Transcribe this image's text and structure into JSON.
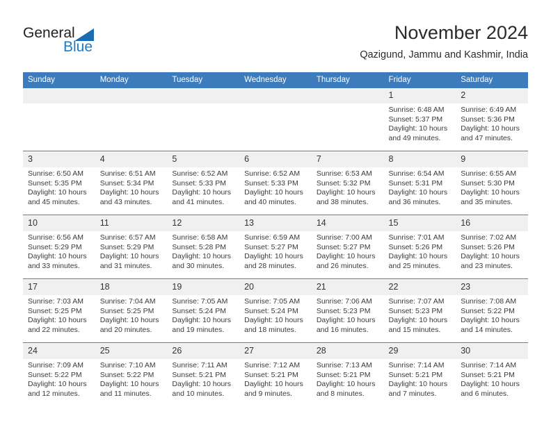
{
  "brand": {
    "name_part1": "General",
    "name_part2": "Blue",
    "triangle_icon": "blue-triangle-icon",
    "color_dark": "#231f20",
    "color_blue": "#1b7bc4"
  },
  "header": {
    "title": "November 2024",
    "subtitle": "Qazigund, Jammu and Kashmir, India"
  },
  "theme": {
    "header_blue": "#3c7cbd",
    "daynum_band": "#f0f0f0",
    "text": "#2b2b2b"
  },
  "calendar": {
    "weekday_headers": [
      "Sunday",
      "Monday",
      "Tuesday",
      "Wednesday",
      "Thursday",
      "Friday",
      "Saturday"
    ],
    "weeks": [
      [
        {
          "day": "",
          "lines": []
        },
        {
          "day": "",
          "lines": []
        },
        {
          "day": "",
          "lines": []
        },
        {
          "day": "",
          "lines": []
        },
        {
          "day": "",
          "lines": []
        },
        {
          "day": "1",
          "lines": [
            "Sunrise: 6:48 AM",
            "Sunset: 5:37 PM",
            "Daylight: 10 hours",
            "and 49 minutes."
          ]
        },
        {
          "day": "2",
          "lines": [
            "Sunrise: 6:49 AM",
            "Sunset: 5:36 PM",
            "Daylight: 10 hours",
            "and 47 minutes."
          ]
        }
      ],
      [
        {
          "day": "3",
          "lines": [
            "Sunrise: 6:50 AM",
            "Sunset: 5:35 PM",
            "Daylight: 10 hours",
            "and 45 minutes."
          ]
        },
        {
          "day": "4",
          "lines": [
            "Sunrise: 6:51 AM",
            "Sunset: 5:34 PM",
            "Daylight: 10 hours",
            "and 43 minutes."
          ]
        },
        {
          "day": "5",
          "lines": [
            "Sunrise: 6:52 AM",
            "Sunset: 5:33 PM",
            "Daylight: 10 hours",
            "and 41 minutes."
          ]
        },
        {
          "day": "6",
          "lines": [
            "Sunrise: 6:52 AM",
            "Sunset: 5:33 PM",
            "Daylight: 10 hours",
            "and 40 minutes."
          ]
        },
        {
          "day": "7",
          "lines": [
            "Sunrise: 6:53 AM",
            "Sunset: 5:32 PM",
            "Daylight: 10 hours",
            "and 38 minutes."
          ]
        },
        {
          "day": "8",
          "lines": [
            "Sunrise: 6:54 AM",
            "Sunset: 5:31 PM",
            "Daylight: 10 hours",
            "and 36 minutes."
          ]
        },
        {
          "day": "9",
          "lines": [
            "Sunrise: 6:55 AM",
            "Sunset: 5:30 PM",
            "Daylight: 10 hours",
            "and 35 minutes."
          ]
        }
      ],
      [
        {
          "day": "10",
          "lines": [
            "Sunrise: 6:56 AM",
            "Sunset: 5:29 PM",
            "Daylight: 10 hours",
            "and 33 minutes."
          ]
        },
        {
          "day": "11",
          "lines": [
            "Sunrise: 6:57 AM",
            "Sunset: 5:29 PM",
            "Daylight: 10 hours",
            "and 31 minutes."
          ]
        },
        {
          "day": "12",
          "lines": [
            "Sunrise: 6:58 AM",
            "Sunset: 5:28 PM",
            "Daylight: 10 hours",
            "and 30 minutes."
          ]
        },
        {
          "day": "13",
          "lines": [
            "Sunrise: 6:59 AM",
            "Sunset: 5:27 PM",
            "Daylight: 10 hours",
            "and 28 minutes."
          ]
        },
        {
          "day": "14",
          "lines": [
            "Sunrise: 7:00 AM",
            "Sunset: 5:27 PM",
            "Daylight: 10 hours",
            "and 26 minutes."
          ]
        },
        {
          "day": "15",
          "lines": [
            "Sunrise: 7:01 AM",
            "Sunset: 5:26 PM",
            "Daylight: 10 hours",
            "and 25 minutes."
          ]
        },
        {
          "day": "16",
          "lines": [
            "Sunrise: 7:02 AM",
            "Sunset: 5:26 PM",
            "Daylight: 10 hours",
            "and 23 minutes."
          ]
        }
      ],
      [
        {
          "day": "17",
          "lines": [
            "Sunrise: 7:03 AM",
            "Sunset: 5:25 PM",
            "Daylight: 10 hours",
            "and 22 minutes."
          ]
        },
        {
          "day": "18",
          "lines": [
            "Sunrise: 7:04 AM",
            "Sunset: 5:25 PM",
            "Daylight: 10 hours",
            "and 20 minutes."
          ]
        },
        {
          "day": "19",
          "lines": [
            "Sunrise: 7:05 AM",
            "Sunset: 5:24 PM",
            "Daylight: 10 hours",
            "and 19 minutes."
          ]
        },
        {
          "day": "20",
          "lines": [
            "Sunrise: 7:05 AM",
            "Sunset: 5:24 PM",
            "Daylight: 10 hours",
            "and 18 minutes."
          ]
        },
        {
          "day": "21",
          "lines": [
            "Sunrise: 7:06 AM",
            "Sunset: 5:23 PM",
            "Daylight: 10 hours",
            "and 16 minutes."
          ]
        },
        {
          "day": "22",
          "lines": [
            "Sunrise: 7:07 AM",
            "Sunset: 5:23 PM",
            "Daylight: 10 hours",
            "and 15 minutes."
          ]
        },
        {
          "day": "23",
          "lines": [
            "Sunrise: 7:08 AM",
            "Sunset: 5:22 PM",
            "Daylight: 10 hours",
            "and 14 minutes."
          ]
        }
      ],
      [
        {
          "day": "24",
          "lines": [
            "Sunrise: 7:09 AM",
            "Sunset: 5:22 PM",
            "Daylight: 10 hours",
            "and 12 minutes."
          ]
        },
        {
          "day": "25",
          "lines": [
            "Sunrise: 7:10 AM",
            "Sunset: 5:22 PM",
            "Daylight: 10 hours",
            "and 11 minutes."
          ]
        },
        {
          "day": "26",
          "lines": [
            "Sunrise: 7:11 AM",
            "Sunset: 5:21 PM",
            "Daylight: 10 hours",
            "and 10 minutes."
          ]
        },
        {
          "day": "27",
          "lines": [
            "Sunrise: 7:12 AM",
            "Sunset: 5:21 PM",
            "Daylight: 10 hours",
            "and 9 minutes."
          ]
        },
        {
          "day": "28",
          "lines": [
            "Sunrise: 7:13 AM",
            "Sunset: 5:21 PM",
            "Daylight: 10 hours",
            "and 8 minutes."
          ]
        },
        {
          "day": "29",
          "lines": [
            "Sunrise: 7:14 AM",
            "Sunset: 5:21 PM",
            "Daylight: 10 hours",
            "and 7 minutes."
          ]
        },
        {
          "day": "30",
          "lines": [
            "Sunrise: 7:14 AM",
            "Sunset: 5:21 PM",
            "Daylight: 10 hours",
            "and 6 minutes."
          ]
        }
      ]
    ]
  }
}
